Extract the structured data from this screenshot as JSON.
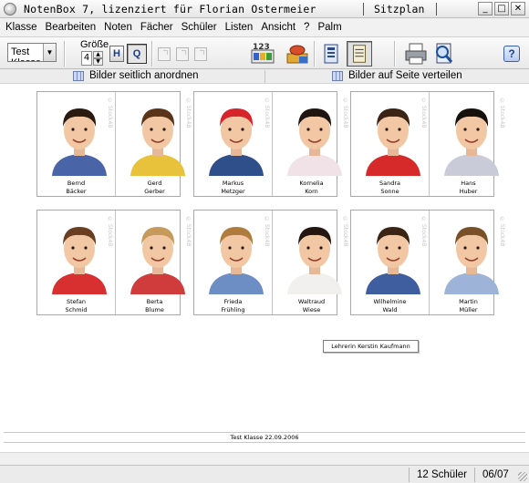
{
  "window": {
    "title": "NotenBox 7, lizenziert für Florian Ostermeier",
    "view": "Sitzplan",
    "minimize": "_",
    "maximize": "□",
    "close": "✕"
  },
  "menu": [
    "Klasse",
    "Bearbeiten",
    "Noten",
    "Fächer",
    "Schüler",
    "Listen",
    "Ansicht",
    "?",
    "Palm"
  ],
  "toolbar": {
    "class_value": "Test Klasse",
    "size_label": "Größe",
    "size_value": "4",
    "h_label": "H",
    "q_label": "Q",
    "help_label": "?",
    "icons": [
      "grades-abc-icon",
      "stamp-edit-icon",
      "column-layout-icon",
      "list-view-icon",
      "print-icon",
      "print-preview-icon",
      "help-icon"
    ]
  },
  "arrange": {
    "side_label": "Bilder seitlich anordnen",
    "page_label": "Bilder auf Seite verteilen"
  },
  "watermark": "© Stock4B",
  "desks": [
    {
      "students": [
        {
          "first": "Bernd",
          "last": "Bäcker",
          "shirt": "#4a64a8",
          "hair": "#2b1a10"
        },
        {
          "first": "Gerd",
          "last": "Gerber",
          "shirt": "#e8c23a",
          "hair": "#5a3418"
        }
      ]
    },
    {
      "students": [
        {
          "first": "Markus",
          "last": "Metzger",
          "shirt": "#2e4f8a",
          "hair": "#d7242a"
        },
        {
          "first": "Kornelia",
          "last": "Korn",
          "shirt": "#f0e2e6",
          "hair": "#1e1410"
        }
      ]
    },
    {
      "students": [
        {
          "first": "Sandra",
          "last": "Sonne",
          "shirt": "#d62a2a",
          "hair": "#3c2414"
        },
        {
          "first": "Hans",
          "last": "Huber",
          "shirt": "#c9ccd8",
          "hair": "#15100c"
        }
      ]
    },
    {
      "students": [
        {
          "first": "Stefan",
          "last": "Schmid",
          "shirt": "#d83030",
          "hair": "#6a3e20"
        },
        {
          "first": "Berta",
          "last": "Blume",
          "shirt": "#d03c3c",
          "hair": "#c59a5a"
        }
      ]
    },
    {
      "students": [
        {
          "first": "Frieda",
          "last": "Frühling",
          "shirt": "#6d8ec5",
          "hair": "#b07c3e"
        },
        {
          "first": "Waltraud",
          "last": "Wiese",
          "shirt": "#f2f0ee",
          "hair": "#241610"
        }
      ]
    },
    {
      "students": [
        {
          "first": "Wilhelmine",
          "last": "Wald",
          "shirt": "#3e5ea0",
          "hair": "#3a2414"
        },
        {
          "first": "Martin",
          "last": "Müller",
          "shirt": "#9db4d8",
          "hair": "#7a5028"
        }
      ]
    }
  ],
  "teacher": "Lehrerin Kerstin Kaufmann",
  "footer": "Test Klasse   22.09.2006",
  "status": {
    "students": "12 Schüler",
    "date": "06/07"
  }
}
